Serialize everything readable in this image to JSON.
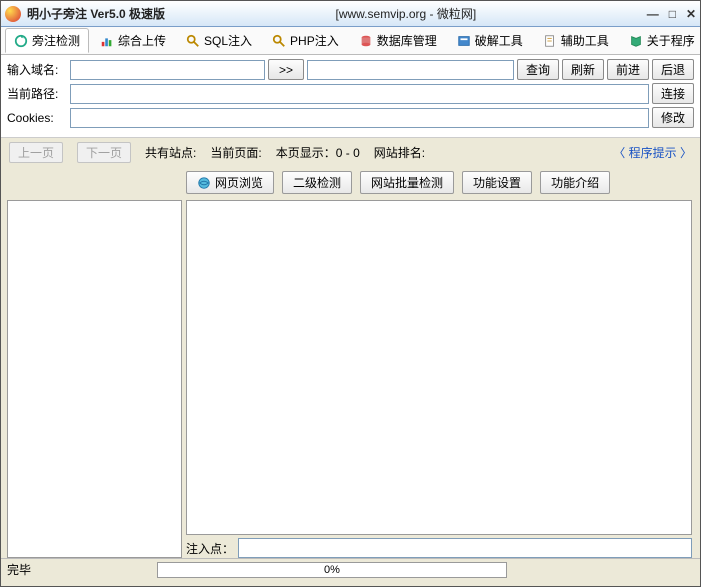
{
  "titlebar": {
    "title": "明小子旁注 Ver5.0 极速版",
    "subtitle": "[www.semvip.org - 微粒网]"
  },
  "tabs": [
    {
      "label": "旁注检测",
      "icon": "refresh-icon",
      "active": true
    },
    {
      "label": "综合上传",
      "icon": "chart-icon"
    },
    {
      "label": "SQL注入",
      "icon": "search-icon"
    },
    {
      "label": "PHP注入",
      "icon": "search-icon"
    },
    {
      "label": "数据库管理",
      "icon": "db-icon"
    },
    {
      "label": "破解工具",
      "icon": "tool-icon"
    },
    {
      "label": "辅助工具",
      "icon": "doc-icon"
    },
    {
      "label": "关于程序",
      "icon": "book-icon"
    }
  ],
  "form": {
    "domain_label": "输入域名:",
    "domain_value": "",
    "go_button": ">>",
    "result_value": "",
    "query": "查询",
    "refresh": "刷新",
    "forward": "前进",
    "back": "后退",
    "path_label": "当前路径:",
    "path_value": "",
    "connect": "连接",
    "cookie_label": "Cookies:",
    "cookie_value": "",
    "modify": "修改"
  },
  "statrow": {
    "prev": "上一页",
    "next": "下一页",
    "sites_label": "共有站点:",
    "page_label": "当前页面:",
    "display_label": "本页显示：",
    "display_value": "0 - 0",
    "rank_label": "网站排名:",
    "hint": "程序提示"
  },
  "midtoolbar": {
    "browse": "网页浏览",
    "second": "二级检测",
    "batch": "网站批量检测",
    "settings": "功能设置",
    "intro": "功能介绍"
  },
  "inject": {
    "label": "注入点：",
    "value": ""
  },
  "statusbar": {
    "status": "完毕",
    "progress_text": "0%"
  }
}
